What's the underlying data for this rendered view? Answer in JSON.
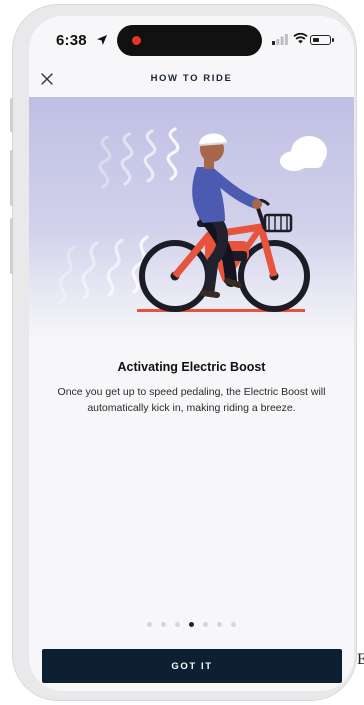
{
  "status_bar": {
    "time": "6:38",
    "icons": [
      "location-arrow-icon",
      "recording-dot-icon",
      "cellular-signal-icon",
      "wifi-icon",
      "battery-icon"
    ]
  },
  "header": {
    "title": "HOW TO RIDE",
    "close_icon": "close-icon"
  },
  "colors": {
    "hero_background": "#c4c4e6",
    "bike_accent": "#e8533b",
    "button_background": "#0d2033",
    "active_dot": "#1f2230"
  },
  "content": {
    "heading": "Activating Electric Boost",
    "body": "Once you get up to speed pedaling, the Electric Boost will automatically kick in, making riding a breeze."
  },
  "pager": {
    "total": 7,
    "current_index": 3
  },
  "actions": {
    "primary_label": "GOT IT"
  },
  "edge_text": "E"
}
